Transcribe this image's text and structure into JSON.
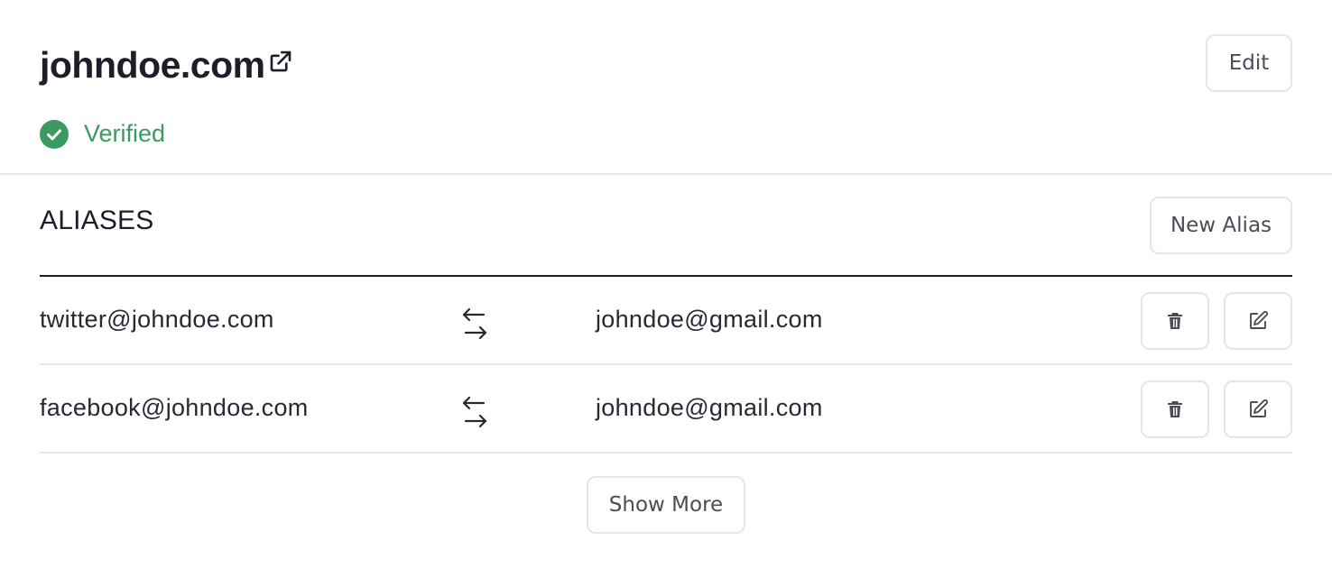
{
  "domain": {
    "name": "johndoe.com",
    "external_link_icon": "external-link-icon",
    "status": "Verified",
    "status_color": "#3a9a62",
    "status_icon": "check-circle-icon",
    "edit_label": "Edit"
  },
  "aliases": {
    "title": "ALIASES",
    "new_label": "New Alias",
    "rows": [
      {
        "alias": "twitter@johndoe.com",
        "target": "johndoe@gmail.com",
        "swap_icon": "swap-arrows-icon",
        "delete_icon": "trash-icon",
        "edit_icon": "pencil-square-icon"
      },
      {
        "alias": "facebook@johndoe.com",
        "target": "johndoe@gmail.com",
        "swap_icon": "swap-arrows-icon",
        "delete_icon": "trash-icon",
        "edit_icon": "pencil-square-icon"
      }
    ],
    "show_more_label": "Show More"
  },
  "colors": {
    "text_primary": "#1c1f2a",
    "border": "#e4e5e8",
    "divider": "#e6e7ea",
    "verified_green": "#3a9a62"
  }
}
